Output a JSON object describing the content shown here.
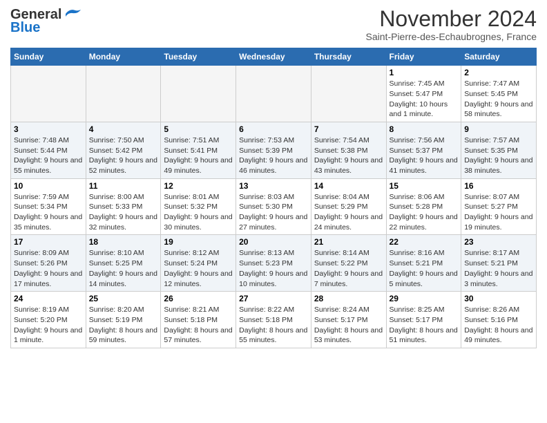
{
  "header": {
    "logo_line1": "General",
    "logo_line2": "Blue",
    "title": "November 2024",
    "subtitle": "Saint-Pierre-des-Echaubrognes, France"
  },
  "days_of_week": [
    "Sunday",
    "Monday",
    "Tuesday",
    "Wednesday",
    "Thursday",
    "Friday",
    "Saturday"
  ],
  "weeks": [
    [
      {
        "day": null,
        "empty": true
      },
      {
        "day": null,
        "empty": true
      },
      {
        "day": null,
        "empty": true
      },
      {
        "day": null,
        "empty": true
      },
      {
        "day": null,
        "empty": true
      },
      {
        "day": 1,
        "sunrise": "7:45 AM",
        "sunset": "5:47 PM",
        "daylight": "10 hours and 1 minute."
      },
      {
        "day": 2,
        "sunrise": "7:47 AM",
        "sunset": "5:45 PM",
        "daylight": "9 hours and 58 minutes."
      }
    ],
    [
      {
        "day": 3,
        "sunrise": "7:48 AM",
        "sunset": "5:44 PM",
        "daylight": "9 hours and 55 minutes."
      },
      {
        "day": 4,
        "sunrise": "7:50 AM",
        "sunset": "5:42 PM",
        "daylight": "9 hours and 52 minutes."
      },
      {
        "day": 5,
        "sunrise": "7:51 AM",
        "sunset": "5:41 PM",
        "daylight": "9 hours and 49 minutes."
      },
      {
        "day": 6,
        "sunrise": "7:53 AM",
        "sunset": "5:39 PM",
        "daylight": "9 hours and 46 minutes."
      },
      {
        "day": 7,
        "sunrise": "7:54 AM",
        "sunset": "5:38 PM",
        "daylight": "9 hours and 43 minutes."
      },
      {
        "day": 8,
        "sunrise": "7:56 AM",
        "sunset": "5:37 PM",
        "daylight": "9 hours and 41 minutes."
      },
      {
        "day": 9,
        "sunrise": "7:57 AM",
        "sunset": "5:35 PM",
        "daylight": "9 hours and 38 minutes."
      }
    ],
    [
      {
        "day": 10,
        "sunrise": "7:59 AM",
        "sunset": "5:34 PM",
        "daylight": "9 hours and 35 minutes."
      },
      {
        "day": 11,
        "sunrise": "8:00 AM",
        "sunset": "5:33 PM",
        "daylight": "9 hours and 32 minutes."
      },
      {
        "day": 12,
        "sunrise": "8:01 AM",
        "sunset": "5:32 PM",
        "daylight": "9 hours and 30 minutes."
      },
      {
        "day": 13,
        "sunrise": "8:03 AM",
        "sunset": "5:30 PM",
        "daylight": "9 hours and 27 minutes."
      },
      {
        "day": 14,
        "sunrise": "8:04 AM",
        "sunset": "5:29 PM",
        "daylight": "9 hours and 24 minutes."
      },
      {
        "day": 15,
        "sunrise": "8:06 AM",
        "sunset": "5:28 PM",
        "daylight": "9 hours and 22 minutes."
      },
      {
        "day": 16,
        "sunrise": "8:07 AM",
        "sunset": "5:27 PM",
        "daylight": "9 hours and 19 minutes."
      }
    ],
    [
      {
        "day": 17,
        "sunrise": "8:09 AM",
        "sunset": "5:26 PM",
        "daylight": "9 hours and 17 minutes."
      },
      {
        "day": 18,
        "sunrise": "8:10 AM",
        "sunset": "5:25 PM",
        "daylight": "9 hours and 14 minutes."
      },
      {
        "day": 19,
        "sunrise": "8:12 AM",
        "sunset": "5:24 PM",
        "daylight": "9 hours and 12 minutes."
      },
      {
        "day": 20,
        "sunrise": "8:13 AM",
        "sunset": "5:23 PM",
        "daylight": "9 hours and 10 minutes."
      },
      {
        "day": 21,
        "sunrise": "8:14 AM",
        "sunset": "5:22 PM",
        "daylight": "9 hours and 7 minutes."
      },
      {
        "day": 22,
        "sunrise": "8:16 AM",
        "sunset": "5:21 PM",
        "daylight": "9 hours and 5 minutes."
      },
      {
        "day": 23,
        "sunrise": "8:17 AM",
        "sunset": "5:21 PM",
        "daylight": "9 hours and 3 minutes."
      }
    ],
    [
      {
        "day": 24,
        "sunrise": "8:19 AM",
        "sunset": "5:20 PM",
        "daylight": "9 hours and 1 minute."
      },
      {
        "day": 25,
        "sunrise": "8:20 AM",
        "sunset": "5:19 PM",
        "daylight": "8 hours and 59 minutes."
      },
      {
        "day": 26,
        "sunrise": "8:21 AM",
        "sunset": "5:18 PM",
        "daylight": "8 hours and 57 minutes."
      },
      {
        "day": 27,
        "sunrise": "8:22 AM",
        "sunset": "5:18 PM",
        "daylight": "8 hours and 55 minutes."
      },
      {
        "day": 28,
        "sunrise": "8:24 AM",
        "sunset": "5:17 PM",
        "daylight": "8 hours and 53 minutes."
      },
      {
        "day": 29,
        "sunrise": "8:25 AM",
        "sunset": "5:17 PM",
        "daylight": "8 hours and 51 minutes."
      },
      {
        "day": 30,
        "sunrise": "8:26 AM",
        "sunset": "5:16 PM",
        "daylight": "8 hours and 49 minutes."
      }
    ]
  ]
}
